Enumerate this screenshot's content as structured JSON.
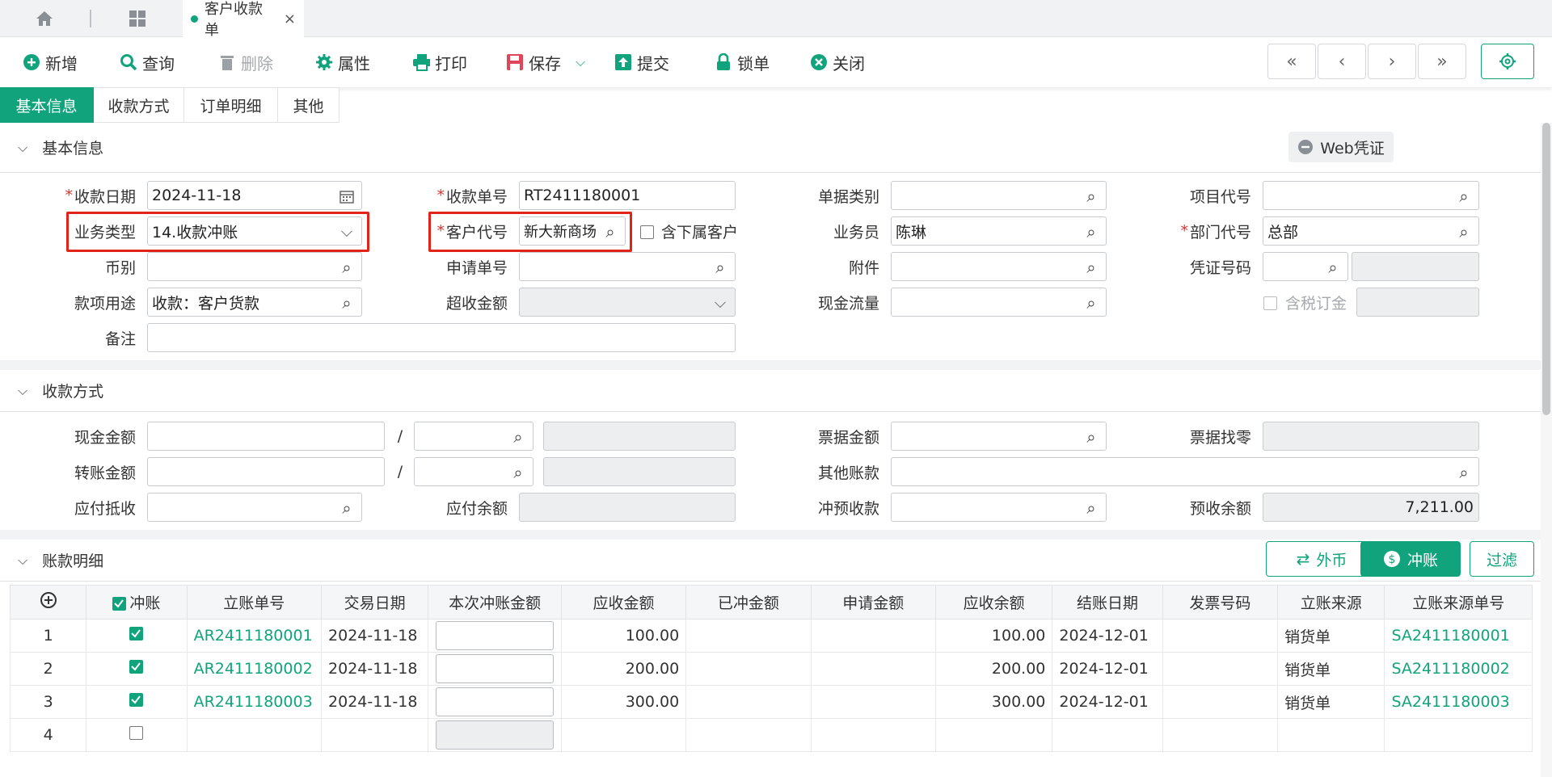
{
  "tabs": {
    "doc_tab": "客户收款单",
    "close": "×"
  },
  "toolbar": {
    "new": "新增",
    "query": "查询",
    "delete": "删除",
    "properties": "属性",
    "print": "打印",
    "save": "保存",
    "submit": "提交",
    "lock": "锁单",
    "close": "关闭"
  },
  "section_tabs": [
    "基本信息",
    "收款方式",
    "订单明细",
    "其他"
  ],
  "basic": {
    "title": "基本信息",
    "web_voucher": "Web凭证",
    "receipt_date_label": "收款日期",
    "receipt_date": "2024-11-18",
    "receipt_no_label": "收款单号",
    "receipt_no": "RT2411180001",
    "doc_type_label": "单据类别",
    "project_code_label": "项目代号",
    "biz_type_label": "业务类型",
    "biz_type": "14.收款冲账",
    "customer_code_label": "客户代号",
    "customer_code": "新大新商场",
    "include_sub_label": "含下属客户",
    "salesperson_label": "业务员",
    "salesperson": "陈琳",
    "dept_code_label": "部门代号",
    "dept_code": "总部",
    "currency_label": "币别",
    "apply_no_label": "申请单号",
    "attachment_label": "附件",
    "voucher_no_label": "凭证号码",
    "purpose_label": "款项用途",
    "purpose": "收款：客户货款",
    "over_amount_label": "超收金额",
    "cash_flow_label": "现金流量",
    "tax_order_label": "含税订金",
    "remark_label": "备注"
  },
  "payment": {
    "title": "收款方式",
    "cash_label": "现金金额",
    "transfer_label": "转账金额",
    "payable_offset_label": "应付抵收",
    "payable_balance_label": "应付余额",
    "bill_amount_label": "票据金额",
    "bill_change_label": "票据找零",
    "other_account_label": "其他账款",
    "prepay_offset_label": "冲预收款",
    "prepay_balance_label": "预收余额",
    "prepay_balance": "7,211.00",
    "slash": "/"
  },
  "detail": {
    "title": "账款明细",
    "btn_fx": "外币",
    "btn_offset": "冲账",
    "btn_filter": "过滤",
    "columns": [
      "冲账",
      "立账单号",
      "交易日期",
      "本次冲账金额",
      "应收金额",
      "已冲金额",
      "申请金额",
      "应收余额",
      "结账日期",
      "发票号码",
      "立账来源",
      "立账来源单号"
    ],
    "rows": [
      {
        "no": "1",
        "doc": "AR2411180001",
        "date": "2024-11-18",
        "recv": "100.00",
        "bal": "100.00",
        "close": "2024-12-01",
        "src": "销货单",
        "src_no": "SA2411180001"
      },
      {
        "no": "2",
        "doc": "AR2411180002",
        "date": "2024-11-18",
        "recv": "200.00",
        "bal": "200.00",
        "close": "2024-12-01",
        "src": "销货单",
        "src_no": "SA2411180002"
      },
      {
        "no": "3",
        "doc": "AR2411180003",
        "date": "2024-11-18",
        "recv": "300.00",
        "bal": "300.00",
        "close": "2024-12-01",
        "src": "销货单",
        "src_no": "SA2411180003"
      },
      {
        "no": "4",
        "doc": "",
        "date": "",
        "recv": "",
        "bal": "",
        "close": "",
        "src": "",
        "src_no": ""
      }
    ]
  },
  "colors": {
    "accent": "#11a47c",
    "highlight": "#e2231a",
    "required": "#e0302b"
  }
}
